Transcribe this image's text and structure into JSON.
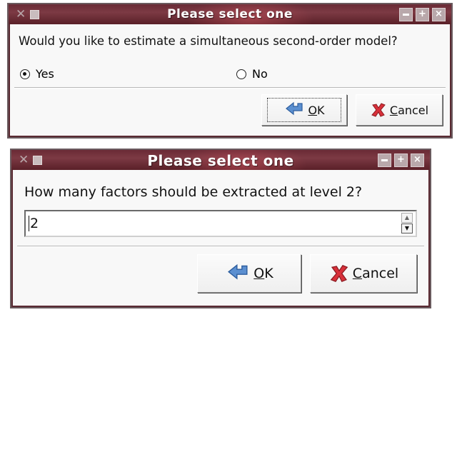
{
  "dialog1": {
    "title": "Please select one",
    "question": "Would you like to estimate a simultaneous second-order model?",
    "options": [
      {
        "label": "Yes",
        "checked": true
      },
      {
        "label": "No",
        "checked": false
      }
    ],
    "ok_mnemonic": "O",
    "ok_rest": "K",
    "cancel_mnemonic": "C",
    "cancel_rest": "ancel"
  },
  "dialog2": {
    "title": "Please select one",
    "question": "How many factors should be extracted at level 2?",
    "input_value": "2",
    "ok_mnemonic": "O",
    "ok_rest": "K",
    "cancel_mnemonic": "C",
    "cancel_rest": "ancel"
  },
  "colors": {
    "titlebar": "#6a2a35",
    "dialog_body": "#f8f8f8",
    "ok_icon": "#5b8fd0",
    "cancel_icon": "#d8303a"
  },
  "icons": {
    "ok": "ok-arrow-icon",
    "cancel": "cancel-x-icon",
    "window_x": "window-menu-icon"
  }
}
